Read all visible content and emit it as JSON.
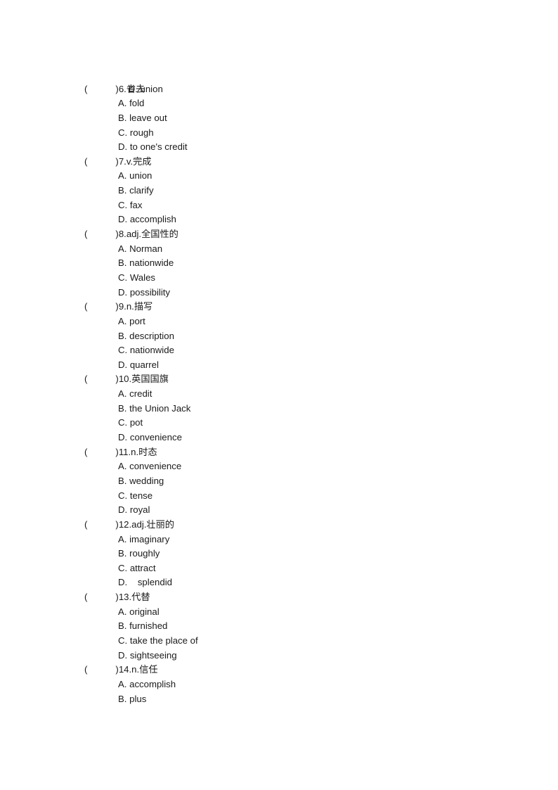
{
  "document": {
    "type": "vocabulary-multiple-choice-worksheet",
    "language_pair": "Chinese-English",
    "page_background": "#ffffff",
    "text_color": "#1a1a1a"
  },
  "orphan_option": {
    "letter": "D.",
    "word": "union",
    "full": "D. union"
  },
  "questions": [
    {
      "paren_open": "(",
      "paren_close": ")",
      "number": "6.",
      "pos": "",
      "prompt": "省去",
      "stem_full": "(      )6.省去",
      "options": [
        {
          "letter": "A.",
          "word": "fold",
          "full": "A. fold"
        },
        {
          "letter": "B.",
          "word": "leave out",
          "full": "B. leave out"
        },
        {
          "letter": "C.",
          "word": "rough",
          "full": "C. rough"
        },
        {
          "letter": "D.",
          "word": "to one's credit",
          "full": "D. to one's credit"
        }
      ]
    },
    {
      "paren_open": "(",
      "paren_close": ")",
      "number": "7.",
      "pos": "v.",
      "prompt": "完成",
      "stem_full": "(      )7.v.完成",
      "options": [
        {
          "letter": "A.",
          "word": "union",
          "full": "A. union"
        },
        {
          "letter": "B.",
          "word": "clarify",
          "full": "B. clarify"
        },
        {
          "letter": "C.",
          "word": "fax",
          "full": "C. fax"
        },
        {
          "letter": "D.",
          "word": "accomplish",
          "full": "D. accomplish"
        }
      ]
    },
    {
      "paren_open": "(",
      "paren_close": ")",
      "number": "8.",
      "pos": "adj.",
      "prompt": "全国性的",
      "stem_full": "(      )8.adj.全国性的",
      "options": [
        {
          "letter": "A.",
          "word": "Norman",
          "full": "A. Norman"
        },
        {
          "letter": "B.",
          "word": "nationwide",
          "full": "B. nationwide"
        },
        {
          "letter": "C.",
          "word": "Wales",
          "full": "C. Wales"
        },
        {
          "letter": "D.",
          "word": "possibility",
          "full": "D. possibility"
        }
      ]
    },
    {
      "paren_open": "(",
      "paren_close": ")",
      "number": "9.",
      "pos": "n.",
      "prompt": "描写",
      "stem_full": "(      )9.n.描写",
      "options": [
        {
          "letter": "A.",
          "word": "port",
          "full": "A. port"
        },
        {
          "letter": "B.",
          "word": "description",
          "full": "B. description"
        },
        {
          "letter": "C.",
          "word": "nationwide",
          "full": "C. nationwide"
        },
        {
          "letter": "D.",
          "word": "quarrel",
          "full": "D. quarrel"
        }
      ]
    },
    {
      "paren_open": "(",
      "paren_close": ")",
      "number": "10.",
      "pos": "",
      "prompt": "英国国旗",
      "stem_full": "(      )10.英国国旗",
      "options": [
        {
          "letter": "A.",
          "word": "credit",
          "full": "A. credit"
        },
        {
          "letter": "B.",
          "word": "the Union Jack",
          "full": "B. the Union Jack"
        },
        {
          "letter": "C.",
          "word": "pot",
          "full": "C. pot"
        },
        {
          "letter": "D.",
          "word": "convenience",
          "full": "D. convenience"
        }
      ]
    },
    {
      "paren_open": "(",
      "paren_close": ")",
      "number": "11.",
      "pos": "n.",
      "prompt": "时态",
      "stem_full": "(      )11.n.时态",
      "options": [
        {
          "letter": "A.",
          "word": "convenience",
          "full": "A. convenience"
        },
        {
          "letter": "B.",
          "word": "wedding",
          "full": "B. wedding"
        },
        {
          "letter": "C.",
          "word": "tense",
          "full": "C. tense"
        },
        {
          "letter": "D.",
          "word": "royal",
          "full": "D. royal"
        }
      ]
    },
    {
      "paren_open": "(",
      "paren_close": ")",
      "number": "12.",
      "pos": "adj.",
      "prompt": "壮丽的",
      "stem_full": "(      )12.adj.壮丽的",
      "options": [
        {
          "letter": "A.",
          "word": "imaginary",
          "full": "A. imaginary"
        },
        {
          "letter": "B.",
          "word": "roughly",
          "full": "B. roughly"
        },
        {
          "letter": "C.",
          "word": "attract",
          "full": "C. attract"
        },
        {
          "letter": "D.",
          "word": "splendid",
          "full": "D.    splendid"
        }
      ]
    },
    {
      "paren_open": "(",
      "paren_close": ")",
      "number": "13.",
      "pos": "",
      "prompt": "代替",
      "stem_full": "(      )13.代替",
      "options": [
        {
          "letter": "A.",
          "word": "original",
          "full": "A. original"
        },
        {
          "letter": "B.",
          "word": "furnished",
          "full": "B. furnished"
        },
        {
          "letter": "C.",
          "word": "take the place of",
          "full": "C. take the place of"
        },
        {
          "letter": "D.",
          "word": "sightseeing",
          "full": "D. sightseeing"
        }
      ]
    },
    {
      "paren_open": "(",
      "paren_close": ")",
      "number": "14.",
      "pos": "n.",
      "prompt": "信任",
      "stem_full": "(      )14.n.信任",
      "options": [
        {
          "letter": "A.",
          "word": "accomplish",
          "full": "A. accomplish"
        },
        {
          "letter": "B.",
          "word": "plus",
          "full": "B. plus"
        }
      ]
    }
  ]
}
